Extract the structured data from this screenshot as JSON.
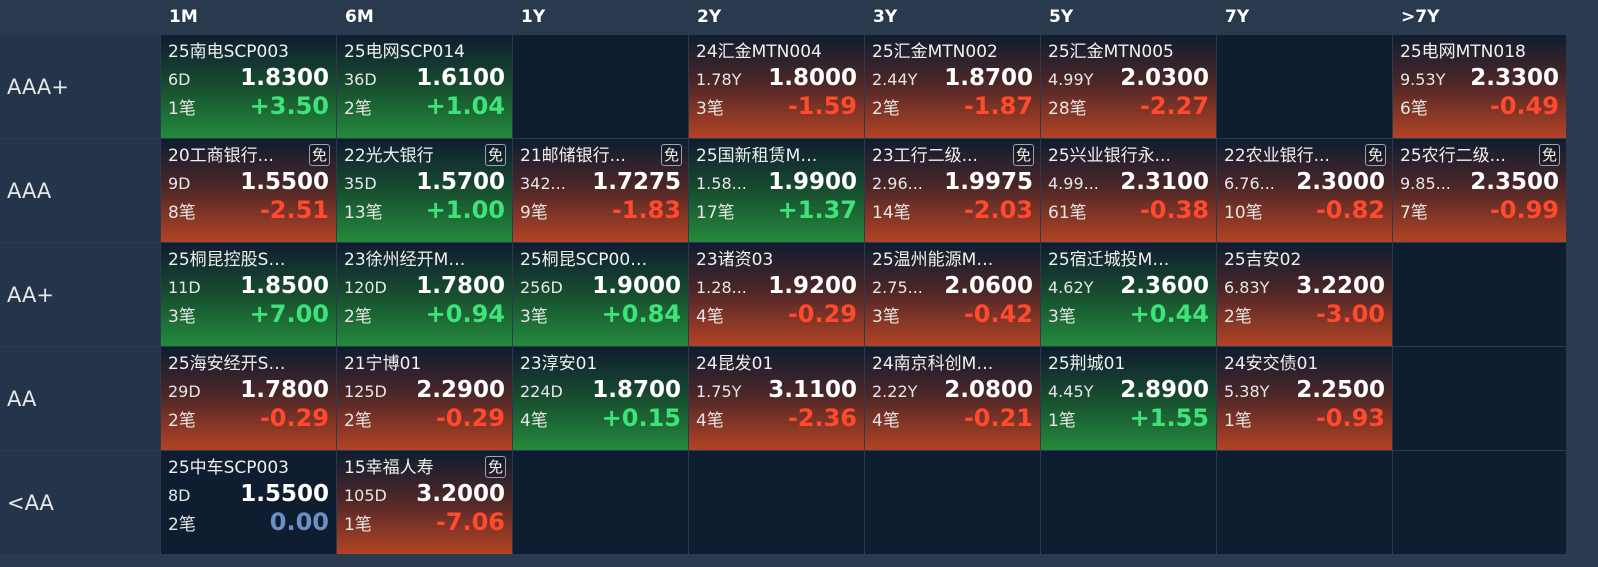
{
  "colors": {
    "up": "#3ee37a",
    "down": "#ff4a2e",
    "zero": "#6b8fc4",
    "background": "#0d1a2b"
  },
  "columns": [
    "1M",
    "6M",
    "1Y",
    "2Y",
    "3Y",
    "5Y",
    "7Y",
    ">7Y"
  ],
  "rows": [
    {
      "rating": "AAA+",
      "cells": [
        {
          "name": "25南电SCP003",
          "tag": "",
          "term": "6D",
          "rate": "1.8300",
          "count": "1笔",
          "change": "+3.50",
          "dir": "up"
        },
        {
          "name": "25电网SCP014",
          "tag": "",
          "term": "36D",
          "rate": "1.6100",
          "count": "2笔",
          "change": "+1.04",
          "dir": "up"
        },
        null,
        {
          "name": "24汇金MTN004",
          "tag": "",
          "term": "1.78Y",
          "rate": "1.8000",
          "count": "3笔",
          "change": "-1.59",
          "dir": "down"
        },
        {
          "name": "25汇金MTN002",
          "tag": "",
          "term": "2.44Y",
          "rate": "1.8700",
          "count": "2笔",
          "change": "-1.87",
          "dir": "down"
        },
        {
          "name": "25汇金MTN005",
          "tag": "",
          "term": "4.99Y",
          "rate": "2.0300",
          "count": "28笔",
          "change": "-2.27",
          "dir": "down"
        },
        null,
        {
          "name": "25电网MTN018",
          "tag": "",
          "term": "9.53Y",
          "rate": "2.3300",
          "count": "6笔",
          "change": "-0.49",
          "dir": "down"
        }
      ]
    },
    {
      "rating": "AAA",
      "cells": [
        {
          "name": "20工商银行...",
          "tag": "免",
          "term": "9D",
          "rate": "1.5500",
          "count": "8笔",
          "change": "-2.51",
          "dir": "down"
        },
        {
          "name": "22光大银行",
          "tag": "免",
          "term": "35D",
          "rate": "1.5700",
          "count": "13笔",
          "change": "+1.00",
          "dir": "up"
        },
        {
          "name": "21邮储银行...",
          "tag": "免",
          "term": "342...",
          "rate": "1.7275",
          "count": "9笔",
          "change": "-1.83",
          "dir": "down"
        },
        {
          "name": "25国新租赁MT...",
          "tag": "",
          "term": "1.58...",
          "rate": "1.9900",
          "count": "17笔",
          "change": "+1.37",
          "dir": "up"
        },
        {
          "name": "23工行二级...",
          "tag": "免",
          "term": "2.96...",
          "rate": "1.9975",
          "count": "14笔",
          "change": "-2.03",
          "dir": "down"
        },
        {
          "name": "25兴业银行永...",
          "tag": "",
          "term": "4.99...",
          "rate": "2.3100",
          "count": "61笔",
          "change": "-0.38",
          "dir": "down"
        },
        {
          "name": "22农业银行...",
          "tag": "免",
          "term": "6.76...",
          "rate": "2.3000",
          "count": "10笔",
          "change": "-0.82",
          "dir": "down"
        },
        {
          "name": "25农行二级...",
          "tag": "免",
          "term": "9.85...",
          "rate": "2.3500",
          "count": "7笔",
          "change": "-0.99",
          "dir": "down"
        }
      ]
    },
    {
      "rating": "AA+",
      "cells": [
        {
          "name": "25桐昆控股SCP...",
          "tag": "",
          "term": "11D",
          "rate": "1.8500",
          "count": "3笔",
          "change": "+7.00",
          "dir": "up"
        },
        {
          "name": "23徐州经开MT...",
          "tag": "",
          "term": "120D",
          "rate": "1.7800",
          "count": "2笔",
          "change": "+0.94",
          "dir": "up"
        },
        {
          "name": "25桐昆SCP008(...",
          "tag": "",
          "term": "256D",
          "rate": "1.9000",
          "count": "3笔",
          "change": "+0.84",
          "dir": "up"
        },
        {
          "name": "23诸资03",
          "tag": "",
          "term": "1.28...",
          "rate": "1.9200",
          "count": "4笔",
          "change": "-0.29",
          "dir": "down"
        },
        {
          "name": "25温州能源MT...",
          "tag": "",
          "term": "2.75...",
          "rate": "2.0600",
          "count": "3笔",
          "change": "-0.42",
          "dir": "down"
        },
        {
          "name": "25宿迁城投MT...",
          "tag": "",
          "term": "4.62Y",
          "rate": "2.3600",
          "count": "3笔",
          "change": "+0.44",
          "dir": "up"
        },
        {
          "name": "25吉安02",
          "tag": "",
          "term": "6.83Y",
          "rate": "3.2200",
          "count": "2笔",
          "change": "-3.00",
          "dir": "down"
        },
        null
      ]
    },
    {
      "rating": "AA",
      "cells": [
        {
          "name": "25海安经开SCP...",
          "tag": "",
          "term": "29D",
          "rate": "1.7800",
          "count": "2笔",
          "change": "-0.29",
          "dir": "down"
        },
        {
          "name": "21宁博01",
          "tag": "",
          "term": "125D",
          "rate": "2.2900",
          "count": "2笔",
          "change": "-0.29",
          "dir": "down"
        },
        {
          "name": "23淳安01",
          "tag": "",
          "term": "224D",
          "rate": "1.8700",
          "count": "4笔",
          "change": "+0.15",
          "dir": "up"
        },
        {
          "name": "24昆发01",
          "tag": "",
          "term": "1.75Y",
          "rate": "3.1100",
          "count": "4笔",
          "change": "-2.36",
          "dir": "down"
        },
        {
          "name": "24南京科创MT...",
          "tag": "",
          "term": "2.22Y",
          "rate": "2.0800",
          "count": "4笔",
          "change": "-0.21",
          "dir": "down"
        },
        {
          "name": "25荆城01",
          "tag": "",
          "term": "4.45Y",
          "rate": "2.8900",
          "count": "1笔",
          "change": "+1.55",
          "dir": "up"
        },
        {
          "name": "24安交债01",
          "tag": "",
          "term": "5.38Y",
          "rate": "2.2500",
          "count": "1笔",
          "change": "-0.93",
          "dir": "down"
        },
        null
      ]
    },
    {
      "rating": "<AA",
      "cells": [
        {
          "name": "25中车SCP003",
          "tag": "",
          "term": "8D",
          "rate": "1.5500",
          "count": "2笔",
          "change": "0.00",
          "dir": "flat"
        },
        {
          "name": "15幸福人寿",
          "tag": "免",
          "term": "105D",
          "rate": "3.2000",
          "count": "1笔",
          "change": "-7.06",
          "dir": "down"
        },
        null,
        null,
        null,
        null,
        null,
        null
      ]
    }
  ]
}
